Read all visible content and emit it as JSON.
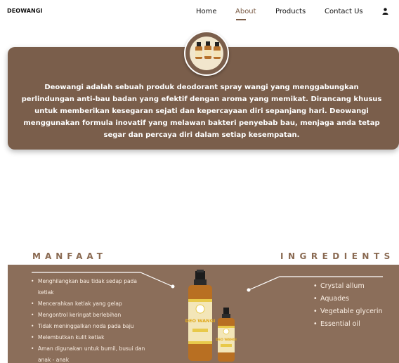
{
  "nav": {
    "brand": "DEOWANGI",
    "links": [
      {
        "label": "Home",
        "active": false
      },
      {
        "label": "About",
        "active": true
      },
      {
        "label": "Products",
        "active": false
      },
      {
        "label": "Contact Us",
        "active": false
      }
    ],
    "user_icon": "user-icon"
  },
  "about": {
    "text": "Deowangi adalah sebuah produk deodorant spray wangi yang menggabungkan perlindungan anti-bau badan yang efektif dengan aroma yang memikat. Dirancang khusus untuk memberikan kesegaran sejati dan kepercayaan diri sepanjang hari. Deowangi menggunakan formula inovatif yang melawan bakteri penyebab bau, menjaga anda tetap segar dan percaya diri dalam setiap kesempatan."
  },
  "manfaat": {
    "title": "MANFAAT",
    "items": [
      "Menghilangkan bau tidak sedap pada ketiak",
      "Mencerahkan ketiak yang gelap",
      "Mengontrol keringat berlebihan",
      "Tidak meninggalkan noda pada baju",
      "Melembutkan kulit ketiak",
      "Aman digunakan untuk bumil, busui dan anak - anak"
    ]
  },
  "ingredients": {
    "title": "INGREDIENTS",
    "items": [
      "Crystal allum",
      "Aquades",
      "Vegetable glycerin",
      "Essential oil"
    ]
  },
  "product_image": {
    "label_big": "DEO WANGI",
    "label_small": "DEO WANGI"
  },
  "colors": {
    "brand_brown": "#7a5e4b",
    "band_brown": "#8b6e5a",
    "heading_brown": "#8a6a52",
    "label_yellow": "#e8c94a"
  }
}
